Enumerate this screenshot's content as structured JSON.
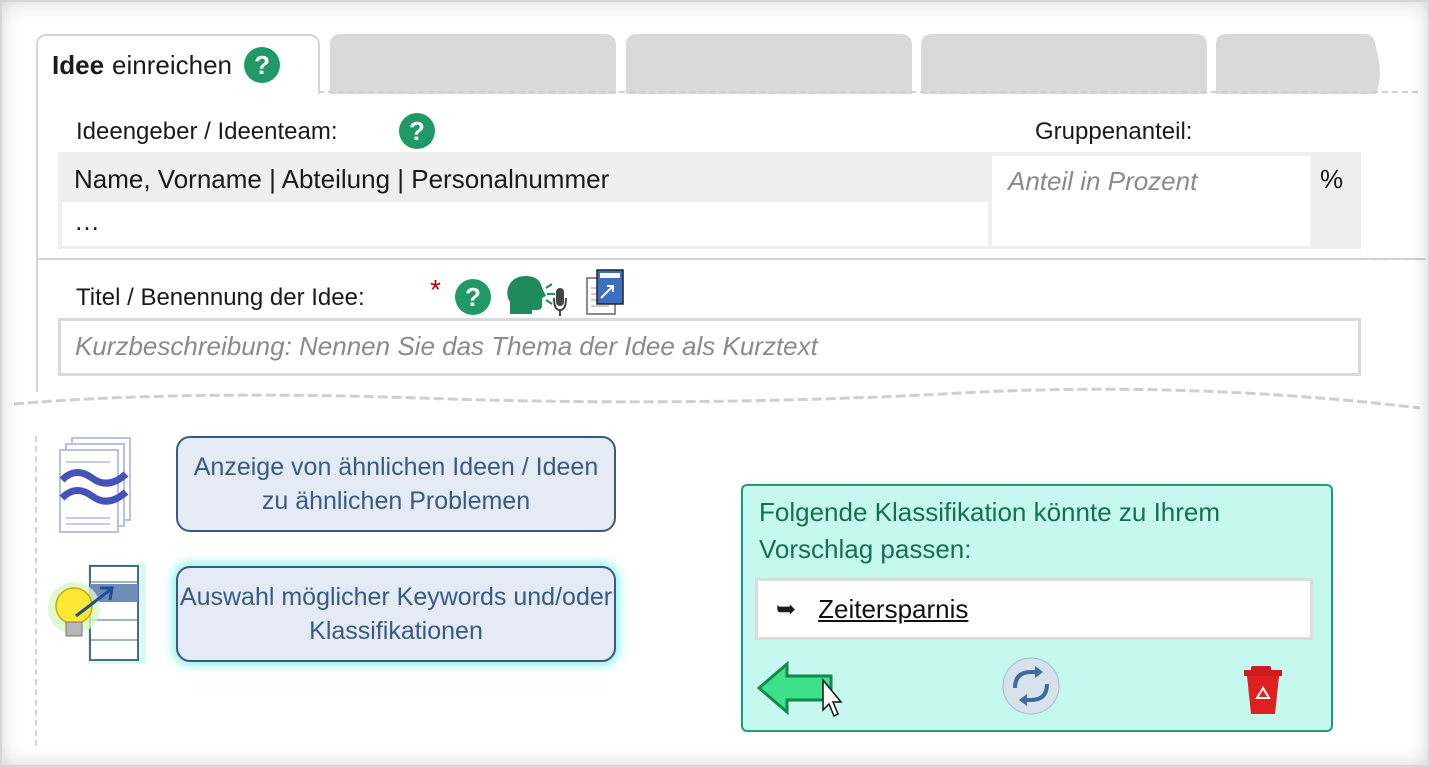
{
  "tabs": {
    "active_bold": "Idee",
    "active_rest": "einreichen",
    "inactive_count": 4
  },
  "team": {
    "label": "Ideengeber / Ideenteam:",
    "share_label": "Gruppenanteil:",
    "name_row": "Name, Vorname | Abteilung | Personalnummer",
    "more_row": "…",
    "share_placeholder": "Anteil in Prozent",
    "percent_unit": "%"
  },
  "title_field": {
    "label": "Titel / Benennung der Idee:",
    "required_mark": "*",
    "placeholder": "Kurzbeschreibung: Nennen Sie das Thema der Idee als Kurztext"
  },
  "help_mark": "?",
  "features": {
    "similar_ideas": "Anzeige von ähnlichen Ideen / Ideen zu ähnlichen Problemen",
    "keywords": "Auswahl möglicher Keywords und/oder Klassifikationen"
  },
  "classification": {
    "prompt": "Folgende Klassifikation könnte zu Ihrem Vorschlag passen:",
    "item_arrow": "➥",
    "item": "Zeitersparnis"
  },
  "colors": {
    "help_green": "#1f9a66",
    "required_red": "#c00000",
    "feature_blue": "#3a5a86",
    "panel_mint": "#c5f8ee"
  },
  "icons": {
    "help": "question-circle-icon",
    "speech": "speaking-head-microphone-icon",
    "title_doc": "title-document-icon",
    "similar": "approx-document-stack-icon",
    "keywords": "lightbulb-list-icon",
    "back": "green-left-arrow-icon",
    "refresh": "refresh-icon",
    "delete": "recycle-bin-icon",
    "cursor": "mouse-cursor-icon"
  }
}
